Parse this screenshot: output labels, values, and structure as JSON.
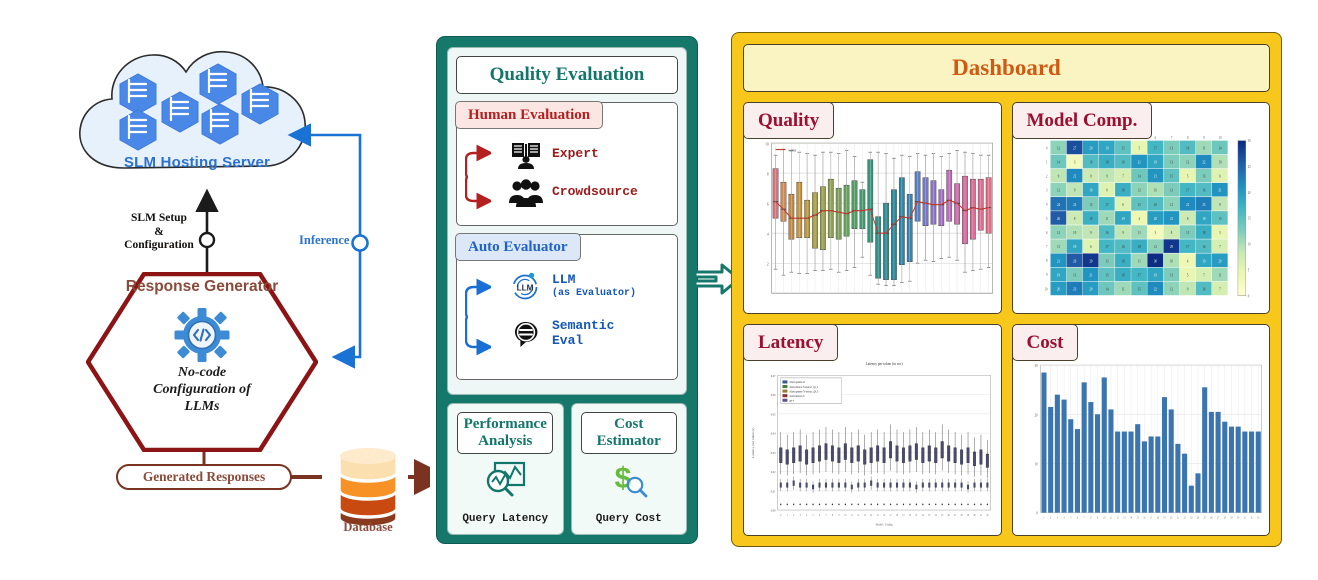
{
  "left": {
    "cloud": {
      "label": "SLM Hosting Server",
      "node_count": 6,
      "icon": "server-hexagon-icon",
      "color": "#2c72d2"
    },
    "setup_edge": {
      "label": "SLM Setup\n&\nConfiguration",
      "line1": "SLM Setup",
      "line2": "&",
      "line3": "Configuration"
    },
    "inference_edge": {
      "label": "Inference",
      "color": "#2c72d2"
    },
    "response_generator": {
      "title": "Response Generator",
      "subtitle_line1": "No-code",
      "subtitle_line2": "Configuration of",
      "subtitle_line3": "LLMs",
      "icon": "gear-code-icon",
      "border_color": "#8c1414",
      "title_color": "#8a4b3a"
    },
    "generated_responses": {
      "label": "Generated Responses",
      "color": "#8a4b3a"
    },
    "database": {
      "label": "Database",
      "icon": "database-cylinder-icon",
      "bands": [
        "#FCDFAE",
        "#F79226",
        "#C94A11",
        "#8A3A1C"
      ]
    }
  },
  "eval_panel": {
    "bg_color": "#16786B",
    "quality_eval": {
      "title": "Quality Evaluation",
      "title_color": "#12766a"
    },
    "human_eval": {
      "title": "Human Evaluation",
      "title_color": "#b2201f",
      "title_bg": "#fbe6e4",
      "items": [
        {
          "label": "Expert",
          "icon": "book-person-icon"
        },
        {
          "label": "Crowdsource",
          "icon": "people-group-icon"
        }
      ]
    },
    "auto_eval": {
      "title": "Auto Evaluator",
      "title_color": "#1f63c8",
      "title_bg": "#dce8f8",
      "items": [
        {
          "label": "LLM",
          "sublabel": "(as Evaluator)",
          "icon": "llm-circle-icon"
        },
        {
          "label": "Semantic",
          "sublabel": "Eval",
          "icon": "speech-bubble-icon"
        }
      ]
    },
    "performance_analysis": {
      "title_line1": "Performance",
      "title_line2": "Analysis",
      "caption": "Query Latency",
      "icon": "chart-magnifier-icon"
    },
    "cost_estimator": {
      "title_line1": "Cost",
      "title_line2": "Estimator",
      "caption": "Query Cost",
      "icon": "dollar-magnifier-icon"
    }
  },
  "flow_arrow": {
    "name": "eval-to-dashboard-arrow",
    "color": "#16786B"
  },
  "dashboard": {
    "title": "Dashboard",
    "title_color": "#cf5a14",
    "bg_color": "#F7C81B",
    "tiles": [
      {
        "name": "quality",
        "label": "Quality"
      },
      {
        "name": "model-comp",
        "label": "Model Comp."
      },
      {
        "name": "latency",
        "label": "Latency"
      },
      {
        "name": "cost",
        "label": "Cost"
      }
    ]
  },
  "chart_data": [
    {
      "type": "bar",
      "name": "quality-boxplot",
      "title": "",
      "xlabel": "",
      "ylabel": "",
      "ylim": [
        0,
        10
      ],
      "yticks": [
        2,
        4,
        6,
        8,
        10
      ],
      "grid": true,
      "legend": "scores",
      "categories": [
        "m1",
        "m2",
        "m3",
        "m4",
        "m5",
        "m6",
        "m7",
        "m8",
        "m9",
        "m10",
        "m11",
        "m12",
        "m13",
        "m14",
        "m15",
        "m16",
        "m17",
        "m18",
        "m19",
        "m20",
        "m21",
        "m22",
        "m23",
        "m24",
        "m25",
        "m26",
        "m27",
        "m28"
      ],
      "boxes": [
        {
          "q1": 5.0,
          "q3": 8.3,
          "med": 6.1,
          "lo": 1.6,
          "hi": 9.2,
          "color": "#d4737c"
        },
        {
          "q1": 4.8,
          "q3": 7.4,
          "med": 5.6,
          "lo": 1.2,
          "hi": 9.6,
          "color": "#cf8a56"
        },
        {
          "q1": 3.6,
          "q3": 6.6,
          "med": 5.0,
          "lo": 1.4,
          "hi": 9.5,
          "color": "#c2893f"
        },
        {
          "q1": 3.7,
          "q3": 7.4,
          "med": 5.0,
          "lo": 1.3,
          "hi": 9.4,
          "color": "#c49440"
        },
        {
          "q1": 3.7,
          "q3": 6.2,
          "med": 5.0,
          "lo": 1.3,
          "hi": 9.3,
          "color": "#b79a3f"
        },
        {
          "q1": 3.0,
          "q3": 6.7,
          "med": 5.2,
          "lo": 1.5,
          "hi": 9.2,
          "color": "#a99f45"
        },
        {
          "q1": 2.9,
          "q3": 7.1,
          "med": 5.5,
          "lo": 1.5,
          "hi": 9.4,
          "color": "#9ba14a"
        },
        {
          "q1": 3.7,
          "q3": 7.6,
          "med": 5.5,
          "lo": 1.6,
          "hi": 9.4,
          "color": "#8ea24e"
        },
        {
          "q1": 3.6,
          "q3": 7.0,
          "med": 5.4,
          "lo": 1.4,
          "hi": 9.3,
          "color": "#7ca055"
        },
        {
          "q1": 3.8,
          "q3": 7.2,
          "med": 5.3,
          "lo": 1.5,
          "hi": 9.5,
          "color": "#66a05e"
        },
        {
          "q1": 4.3,
          "q3": 7.5,
          "med": 5.5,
          "lo": 1.7,
          "hi": 9.1,
          "color": "#539b66"
        },
        {
          "q1": 4.3,
          "q3": 6.9,
          "med": 5.5,
          "lo": 2.4,
          "hi": 7.4,
          "color": "#449a70"
        },
        {
          "q1": 3.4,
          "q3": 8.9,
          "med": 5.6,
          "lo": 1.2,
          "hi": 9.4,
          "color": "#38957b"
        },
        {
          "q1": 1.0,
          "q3": 5.1,
          "med": 4.0,
          "lo": 0.6,
          "hi": 9.4,
          "color": "#2e8f85"
        },
        {
          "q1": 0.9,
          "q3": 6.0,
          "med": 4.0,
          "lo": 0.5,
          "hi": 9.3,
          "color": "#2c8b90"
        },
        {
          "q1": 0.9,
          "q3": 6.9,
          "med": 4.6,
          "lo": 0.5,
          "hi": 9.0,
          "color": "#2a869a"
        },
        {
          "q1": 1.9,
          "q3": 7.7,
          "med": 5.1,
          "lo": 0.7,
          "hi": 9.2,
          "color": "#2f84a2"
        },
        {
          "q1": 2.1,
          "q3": 6.6,
          "med": 5.0,
          "lo": 0.8,
          "hi": 9.1,
          "color": "#3a82ab"
        },
        {
          "q1": 4.8,
          "q3": 8.1,
          "med": 6.1,
          "lo": 2.0,
          "hi": 9.3,
          "color": "#5a7fc0"
        },
        {
          "q1": 4.5,
          "q3": 7.7,
          "med": 6.0,
          "lo": 2.2,
          "hi": 9.2,
          "color": "#7478c4"
        },
        {
          "q1": 4.6,
          "q3": 7.5,
          "med": 5.9,
          "lo": 2.1,
          "hi": 9.3,
          "color": "#8a73c2"
        },
        {
          "q1": 4.5,
          "q3": 6.9,
          "med": 5.9,
          "lo": 2.3,
          "hi": 9.1,
          "color": "#a06fbd"
        },
        {
          "q1": 4.8,
          "q3": 8.2,
          "med": 6.2,
          "lo": 2.4,
          "hi": 9.3,
          "color": "#b96eb6"
        },
        {
          "q1": 4.6,
          "q3": 7.3,
          "med": 6.0,
          "lo": 2.2,
          "hi": 9.5,
          "color": "#c96ca8"
        },
        {
          "q1": 3.3,
          "q3": 7.8,
          "med": 5.5,
          "lo": 1.4,
          "hi": 9.4,
          "color": "#d66a9d"
        },
        {
          "q1": 3.6,
          "q3": 7.6,
          "med": 5.7,
          "lo": 1.5,
          "hi": 9.3,
          "color": "#dc6a93"
        },
        {
          "q1": 4.2,
          "q3": 7.6,
          "med": 5.6,
          "lo": 1.6,
          "hi": 9.2,
          "color": "#e06b8c"
        },
        {
          "q1": 4.0,
          "q3": 7.7,
          "med": 5.7,
          "lo": 1.7,
          "hi": 9.2,
          "color": "#e36c86"
        }
      ],
      "trendline": [
        6.1,
        5.6,
        5.0,
        5.0,
        5.0,
        5.2,
        5.5,
        5.5,
        5.4,
        5.3,
        5.5,
        5.5,
        5.6,
        4.0,
        4.0,
        4.6,
        5.1,
        5.0,
        6.1,
        6.0,
        5.9,
        5.9,
        6.2,
        6.0,
        5.5,
        5.7,
        5.6,
        5.7
      ],
      "trend_color": "#c0392b"
    },
    {
      "type": "heatmap",
      "name": "model-comparison-heatmap",
      "title": "",
      "xlabel": "",
      "ylabel": "",
      "rows": 11,
      "cols": 11,
      "colormap": "YlGnBu",
      "colorbar": {
        "ticks": [
          0,
          5,
          10,
          15,
          20,
          25,
          30
        ],
        "min": 0,
        "max": 30
      },
      "values": [
        [
          12,
          27,
          20,
          19,
          15,
          5,
          17,
          13,
          16,
          11,
          14
        ],
        [
          14,
          3,
          16,
          18,
          16,
          21,
          19,
          13,
          12,
          22,
          10
        ],
        [
          9,
          22,
          8,
          9,
          7,
          14,
          21,
          15,
          5,
          13,
          6
        ],
        [
          12,
          9,
          19,
          6,
          18,
          12,
          10,
          13,
          17,
          16,
          21
        ],
        [
          24,
          23,
          13,
          17,
          6,
          15,
          16,
          12,
          22,
          23,
          9
        ],
        [
          26,
          8,
          18,
          11,
          19,
          4,
          20,
          21,
          8,
          19,
          15
        ],
        [
          12,
          10,
          9,
          16,
          9,
          11,
          3,
          8,
          13,
          18,
          5
        ],
        [
          11,
          19,
          6,
          17,
          16,
          18,
          12,
          29,
          17,
          16,
          7
        ],
        [
          21,
          26,
          29,
          13,
          18,
          11,
          30,
          10,
          4,
          19,
          20
        ],
        [
          19,
          13,
          21,
          15,
          18,
          17,
          19,
          13,
          5,
          7,
          11
        ],
        [
          20,
          23,
          20,
          14,
          11,
          15,
          22,
          12,
          9,
          16,
          7
        ]
      ]
    },
    {
      "type": "bar",
      "name": "latency-boxplot",
      "title": "Latency per token (in sec)",
      "xlabel": "Model / Config",
      "ylabel": "Latency per token (s)",
      "ylim": [
        0.0,
        0.07
      ],
      "yticks": [
        0.0,
        0.01,
        0.02,
        0.03,
        0.04,
        0.05,
        0.06,
        0.07
      ],
      "grid": true,
      "legend_position": "upper left",
      "legend": [
        {
          "label": "ollama/gemma-2b",
          "color": "#3b5a8c"
        },
        {
          "label": "ollama/mistral-7b-instruct_Q4_0",
          "color": "#4a7c3f"
        },
        {
          "label": "ollama/gemma-7b-instruct_Q4_0",
          "color": "#9a7b34"
        },
        {
          "label": "ollama/llama2-7b",
          "color": "#8c3030"
        },
        {
          "label": "gpt-4",
          "color": "#5f4f8c"
        }
      ],
      "series": [
        {
          "name": "band-high",
          "values": [
            0.03,
            0.029,
            0.03,
            0.031,
            0.029,
            0.03,
            0.031,
            0.032,
            0.031,
            0.03,
            0.032,
            0.03,
            0.031,
            0.029,
            0.03,
            0.031,
            0.03,
            0.033,
            0.031,
            0.03,
            0.031,
            0.032,
            0.03,
            0.031,
            0.03,
            0.033,
            0.031,
            0.03,
            0.029,
            0.03,
            0.028,
            0.029,
            0.027
          ]
        },
        {
          "name": "band-low",
          "values": [
            0.013,
            0.013,
            0.014,
            0.013,
            0.013,
            0.012,
            0.013,
            0.013,
            0.013,
            0.013,
            0.013,
            0.012,
            0.013,
            0.013,
            0.014,
            0.013,
            0.013,
            0.013,
            0.013,
            0.013,
            0.013,
            0.012,
            0.013,
            0.013,
            0.013,
            0.013,
            0.013,
            0.013,
            0.013,
            0.012,
            0.013,
            0.013,
            0.013
          ]
        },
        {
          "name": "band-base",
          "values": [
            0.003,
            0.003,
            0.003,
            0.003,
            0.003,
            0.003,
            0.003,
            0.003,
            0.003,
            0.003,
            0.003,
            0.003,
            0.003,
            0.003,
            0.003,
            0.003,
            0.003,
            0.003,
            0.003,
            0.003,
            0.003,
            0.003,
            0.003,
            0.003,
            0.003,
            0.003,
            0.003,
            0.003,
            0.003,
            0.003,
            0.003,
            0.003,
            0.003
          ]
        }
      ]
    },
    {
      "type": "bar",
      "name": "cost-barchart",
      "title": "",
      "xlabel": "",
      "ylabel": "",
      "ylim": [
        0,
        30
      ],
      "yticks": [
        0,
        10,
        20,
        30
      ],
      "grid": true,
      "bar_color": "#3b75af",
      "categories": [
        "1",
        "2",
        "3",
        "4",
        "5",
        "6",
        "7",
        "8",
        "9",
        "10",
        "11",
        "12",
        "13",
        "14",
        "15",
        "16",
        "17",
        "18",
        "19",
        "20",
        "21",
        "22",
        "23",
        "24",
        "25",
        "26",
        "27",
        "28",
        "29",
        "30",
        "31",
        "32",
        "33"
      ],
      "values": [
        28.5,
        21.5,
        24.0,
        23.0,
        19.0,
        17.0,
        26.5,
        22.5,
        20.0,
        27.5,
        21.0,
        16.5,
        16.5,
        16.5,
        18.0,
        14.5,
        15.5,
        15.5,
        23.5,
        21.0,
        14.0,
        12.0,
        5.5,
        8.0,
        25.5,
        20.5,
        20.5,
        18.5,
        17.5,
        17.5,
        16.5,
        16.5,
        16.5
      ]
    }
  ]
}
